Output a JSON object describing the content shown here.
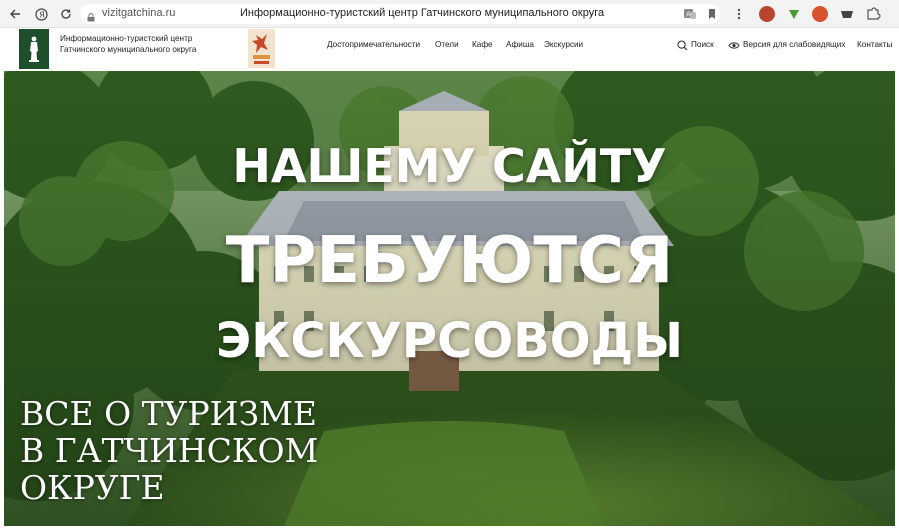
{
  "browser": {
    "url_host": "vizitgatchina.ru",
    "tab_title": "Информационно-туристский центр Гатчинского муниципального округа",
    "icons": [
      "back-arrow-icon",
      "yandex-icon",
      "reload-icon",
      "lock-icon",
      "translate-icon",
      "bookmark-icon",
      "menu-dots-icon"
    ],
    "extensions": [
      "extension-red-icon",
      "extension-green-icon",
      "extension-orange-icon",
      "extension-dark-icon",
      "extension-puzzle-icon"
    ]
  },
  "site": {
    "brand_line1": "Информационно-туристский центр",
    "brand_line2": "Гатчинского муниципального округа",
    "nav": [
      "Достопримечательности",
      "Отели",
      "Кафе",
      "Афиша",
      "Экскурсии"
    ],
    "search_label": "Поиск",
    "accessibility_label": "Версия для слабовидящих",
    "contacts_label": "Контакты",
    "colors": {
      "logo_bg": "#1f4e2b",
      "poster_accent": "#c94a2a"
    }
  },
  "hero": {
    "headline_1": "НАШЕМУ САЙТУ",
    "headline_2": "ТРЕБУЮТСЯ",
    "headline_3": "ЭКСКУРСОВОДЫ",
    "tagline_1": "ВСЕ О ТУРИЗМЕ",
    "tagline_2": "В ГАТЧИНСКОМ",
    "tagline_3": "ОКРУГЕ"
  }
}
